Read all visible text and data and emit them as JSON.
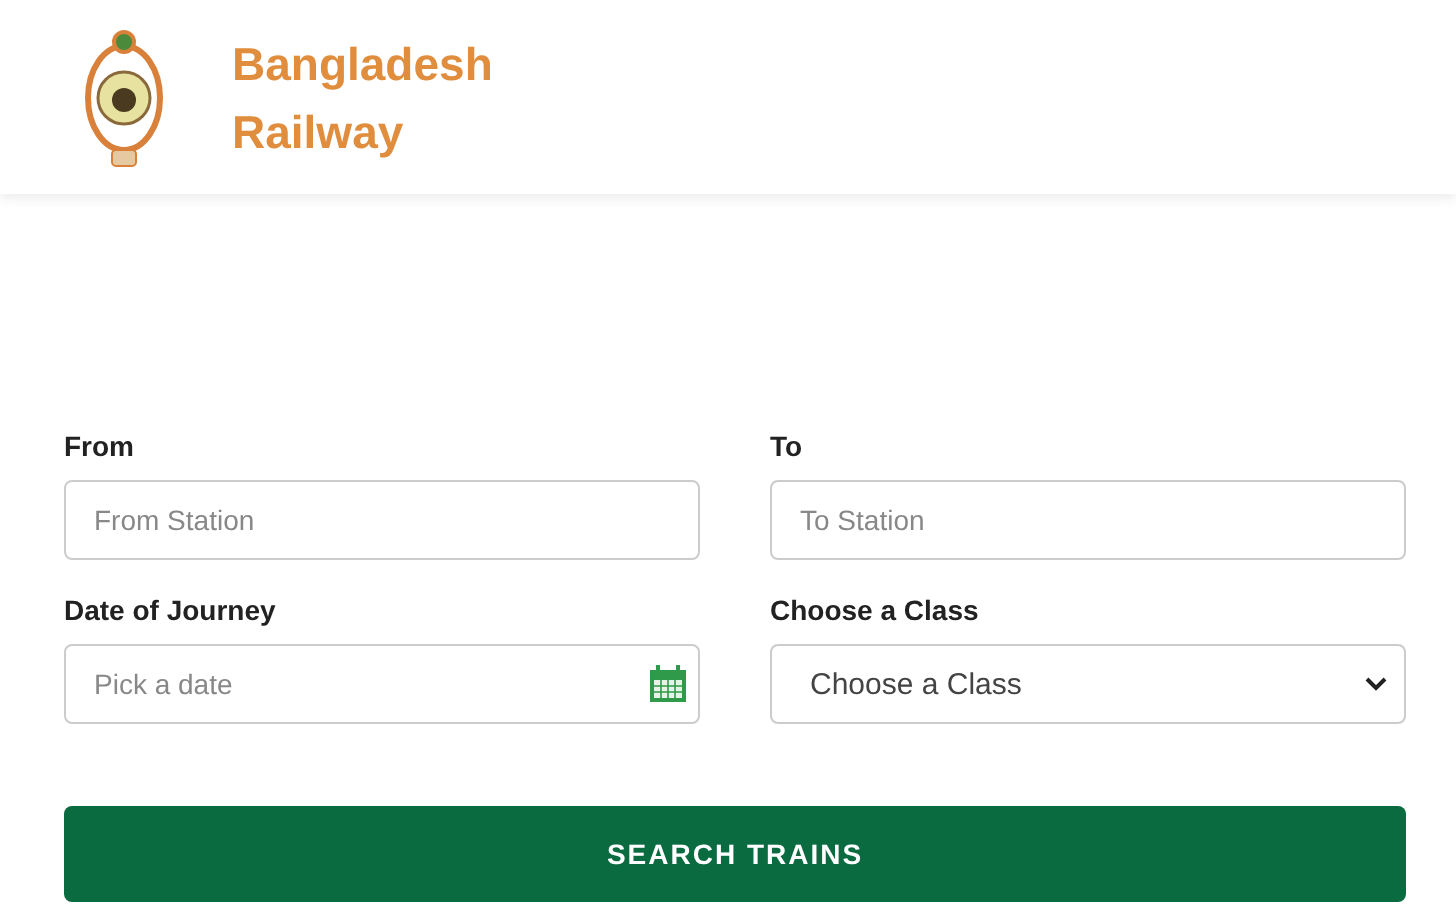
{
  "header": {
    "title_lines": [
      "Bangladesh",
      "Railway"
    ]
  },
  "form": {
    "fields": [
      {
        "kind": "text",
        "label": "From",
        "placeholder": "From Station"
      },
      {
        "kind": "text",
        "label": "To",
        "placeholder": "To Station"
      },
      {
        "kind": "date",
        "label": "Date of Journey",
        "placeholder": "Pick a date"
      },
      {
        "kind": "select",
        "label": "Choose a Class",
        "value": "Choose a Class"
      }
    ],
    "submit": "SEARCH TRAINS"
  }
}
